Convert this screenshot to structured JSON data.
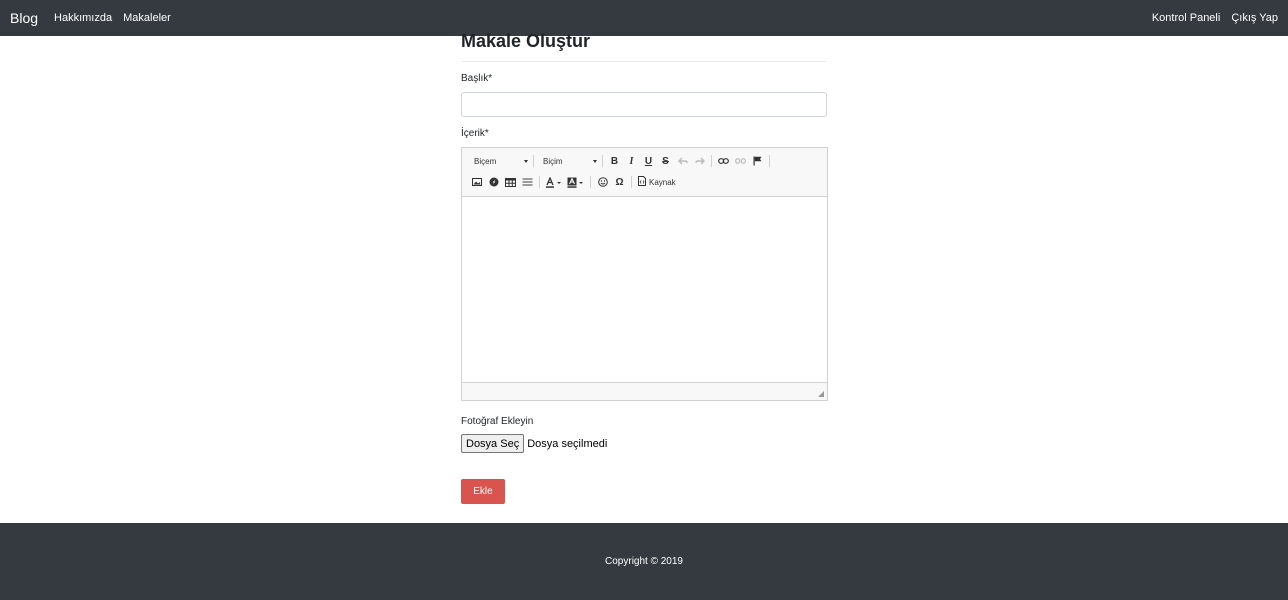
{
  "navbar": {
    "brand": "Blog",
    "left_links": [
      "Hakkımızda",
      "Makaleler"
    ],
    "right_links": [
      "Kontrol Paneli",
      "Çıkış Yap"
    ]
  },
  "form": {
    "page_title": "Makale Oluştur",
    "title_label": "Başlık*",
    "title_value": "",
    "content_label": "İçerik*",
    "photo_label": "Fotoğraf Ekleyin",
    "file_button": "Dosya Seç",
    "file_status": "Dosya seçilmedi",
    "submit": "Ekle",
    "submit_color": "#d9534f"
  },
  "editor": {
    "styles_combo": "Biçem",
    "format_combo": "Biçim",
    "bold": "B",
    "italic": "I",
    "underline": "U",
    "strike": "S",
    "omega": "Ω",
    "source": "Kaynak",
    "icons": [
      "bold-icon",
      "italic-icon",
      "underline-icon",
      "strikethrough-icon",
      "undo-icon",
      "redo-icon",
      "link-icon",
      "unlink-icon",
      "anchor-flag-icon",
      "image-icon",
      "flash-icon",
      "table-icon",
      "horizontal-rule-icon",
      "text-color-icon",
      "background-color-icon",
      "smiley-icon",
      "special-char-icon",
      "source-icon"
    ]
  },
  "footer": {
    "copyright": "Copyright © 2019"
  },
  "colors": {
    "navbar_bg": "#343a40",
    "footer_bg": "#343a40"
  }
}
